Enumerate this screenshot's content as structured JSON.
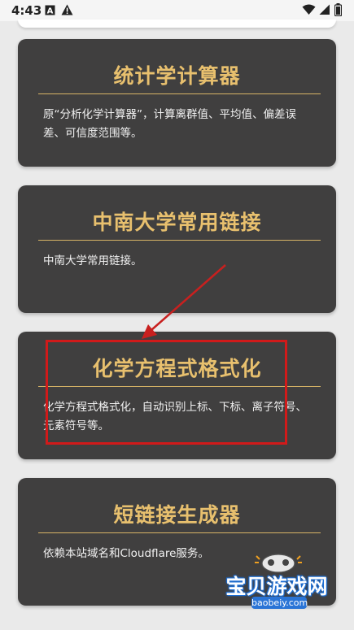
{
  "status_bar": {
    "time": "4:43",
    "left_icons": [
      "a-box-icon",
      "warning-icon"
    ],
    "right_icons": [
      "wifi-icon",
      "signal-icon",
      "battery-icon"
    ]
  },
  "cards": [
    {
      "title": "统计学计算器",
      "desc": "原“分析化学计算器”，计算离群值、平均值、偏差误差、可信度范围等。"
    },
    {
      "title": "中南大学常用链接",
      "desc": "中南大学常用链接。"
    },
    {
      "title": "化学方程式格式化",
      "desc": "化学方程式格式化，自动识别上标、下标、离子符号、元素符号等。"
    },
    {
      "title": "短链接生成器",
      "desc": "依赖本站域名和Cloudflare服务。"
    }
  ],
  "watermark": {
    "text": "宝贝游戏网",
    "sub": "baobeiy.com"
  },
  "colors": {
    "card_bg": "#403f3f",
    "title": "#e8c06e",
    "highlight": "#d11a1a"
  }
}
